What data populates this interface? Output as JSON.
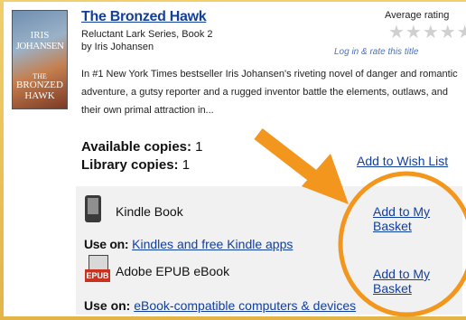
{
  "book": {
    "title": "The Bronzed Hawk",
    "series": "Reluctant Lark Series, Book 2",
    "author": "by Iris Johansen",
    "description": "In #1 New York Times bestseller Iris Johansen's riveting novel of danger and romantic adventure, a gutsy reporter and a rugged inventor battle the elements, outlaws, and their own primal attraction in..."
  },
  "cover": {
    "line1": "IRIS",
    "line2": "JOHANSEN",
    "line3": "THE",
    "line4": "BRONZED",
    "line5": "HAWK"
  },
  "rating": {
    "label": "Average rating",
    "stars": "★★★★★",
    "value": 0,
    "login_text": "Log in & rate this title"
  },
  "availability": {
    "available_label": "Available copies:",
    "available_count": "1",
    "library_label": "Library copies:",
    "library_count": "1",
    "wish_list": "Add to Wish List"
  },
  "formats": [
    {
      "name": "Kindle Book",
      "icon": "kindle-device-icon",
      "add_label": "Add to My Basket",
      "use_on_label": "Use on:",
      "use_on_link": "Kindles and free Kindle apps"
    },
    {
      "name": "Adobe EPUB eBook",
      "icon": "epub-icon",
      "icon_label": "EPUB",
      "add_label": "Add to My Basket",
      "use_on_label": "Use on:",
      "use_on_link": "eBook-compatible computers & devices"
    }
  ],
  "annotation": {
    "color": "#f2961e",
    "shape": "arrow-pointing-to-circled-add-buttons"
  }
}
